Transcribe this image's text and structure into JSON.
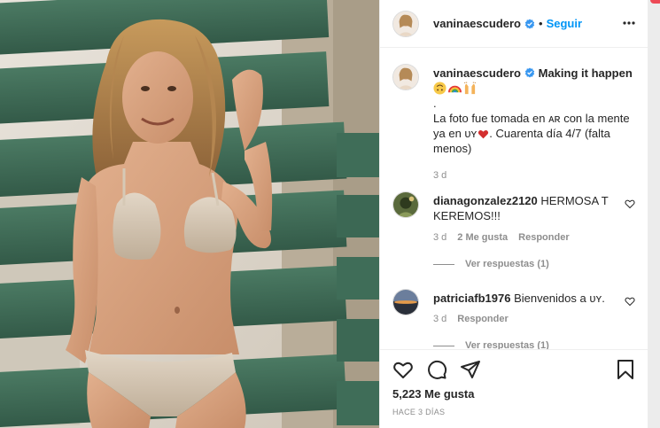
{
  "post": {
    "username": "vaninaescudero",
    "follow_label": "Seguir",
    "separator": "•",
    "colors": {
      "accent": "#0095f6",
      "verified": "#3897f0",
      "text": "#262626",
      "muted": "#8e8e8e"
    }
  },
  "caption": {
    "username": "vaninaescudero",
    "title": "Making it happen",
    "emojis": [
      "upside-down-face-emoji",
      "rainbow-emoji",
      "raising-hands-emoji"
    ],
    "dot": ".",
    "text": "La foto fue tomada en ᴀʀ con la mente ya en ᴜʏ",
    "text_after_heart": ". Cuarenta día 4/7 (falta menos)",
    "time": "3 d"
  },
  "comments": [
    {
      "username": "dianagonzalez2120",
      "text": "HERMOSA T KEREMOS!!!",
      "time": "3 d",
      "likes": "2 Me gusta",
      "reply_label": "Responder",
      "view_replies": "Ver respuestas (1)"
    },
    {
      "username": "patriciafb1976",
      "text": "Bienvenidos a ᴜʏ.",
      "time": "3 d",
      "reply_label": "Responder",
      "view_replies": "Ver respuestas (1)"
    }
  ],
  "footer": {
    "likes": "5,223 Me gusta",
    "posted": "HACE 3 DÍAS"
  },
  "icons": [
    "more-options-icon",
    "verified-badge-icon",
    "like-heart-icon",
    "comment-icon",
    "share-icon",
    "save-bookmark-icon"
  ]
}
